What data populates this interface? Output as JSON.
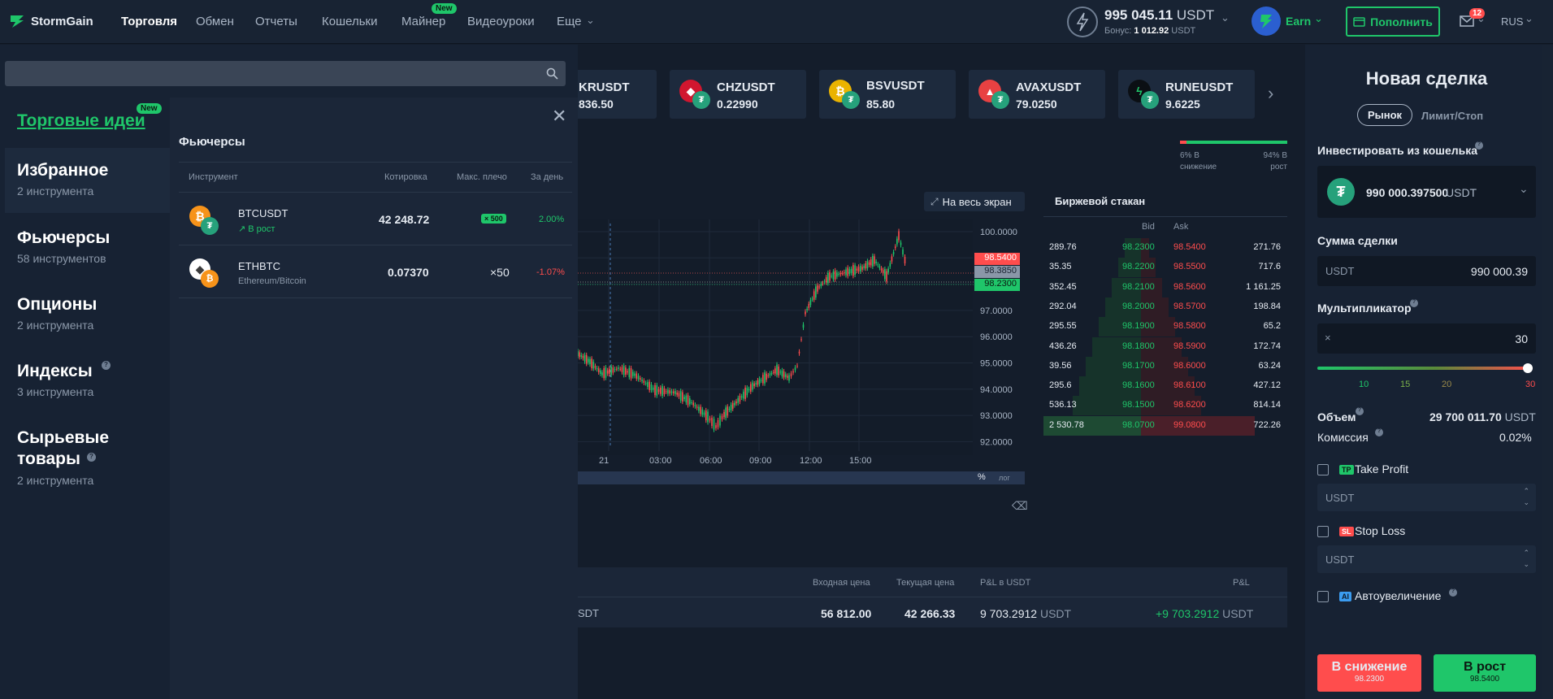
{
  "brand": "StormGain",
  "nav": {
    "items": [
      "Торговля",
      "Обмен",
      "Отчеты",
      "Кошельки",
      "Майнер",
      "Видеоуроки",
      "Еще"
    ],
    "new_badge": "New"
  },
  "balance": {
    "amount": "995 045.11",
    "currency": "USDT",
    "bonus_label": "Бонус:",
    "bonus_value": "1 012.92",
    "bonus_currency": "USDT"
  },
  "earn_label": "Earn",
  "deposit_label": "Пополнить",
  "mail_count": "12",
  "language": "RUS",
  "tickers": [
    {
      "symbol": "KRUSDT",
      "price": "836.50"
    },
    {
      "symbol": "CHZUSDT",
      "price": "0.22990"
    },
    {
      "symbol": "BSVUSDT",
      "price": "85.80"
    },
    {
      "symbol": "AVAXUSDT",
      "price": "79.0250"
    },
    {
      "symbol": "RUNEUSDT",
      "price": "9.6225"
    }
  ],
  "sentiment": {
    "down": "6% В снижение",
    "up": "94% В рост",
    "down_pct": 6,
    "up_pct": 94
  },
  "sidebar": {
    "trade_ideas": "Торговые идеи",
    "new_badge": "New",
    "categories": [
      {
        "title": "Избранное",
        "count": "2 инструмента"
      },
      {
        "title": "Фьючерсы",
        "count": "58 инструментов"
      },
      {
        "title": "Опционы",
        "count": "2 инструмента"
      },
      {
        "title": "Индексы",
        "count": "3 инструмента"
      },
      {
        "title": "Сырьевые товары",
        "count": "2 инструмента"
      }
    ]
  },
  "instrument_panel": {
    "title": "Фьючерсы",
    "columns": [
      "Инструмент",
      "Котировка",
      "Макс. плечо",
      "За день"
    ],
    "rows": [
      {
        "symbol": "BTCUSDT",
        "sub": "В рост",
        "quote": "42 248.72",
        "leverage": "× 500",
        "change": "2.00%"
      },
      {
        "symbol": "ETHBTC",
        "sub": "Ethereum/Bitcoin",
        "quote": "0.07370",
        "leverage": "×50",
        "change": "-1.07%"
      }
    ]
  },
  "chart": {
    "fullscreen_label": "На весь экран",
    "y_ticks": [
      "100.0000",
      "99.0000",
      "98.0000",
      "97.0000",
      "96.0000",
      "95.0000",
      "94.0000",
      "93.0000",
      "92.0000"
    ],
    "x_ticks": [
      "21",
      "03:00",
      "06:00",
      "09:00",
      "12:00",
      "15:00"
    ],
    "ask_tag": "98.5400",
    "mid_tag": "98.3850",
    "bid_tag": "98.2300",
    "pct_label": "%",
    "log_label": "лог"
  },
  "orderbook": {
    "title": "Биржевой стакан",
    "bid_label": "Bid",
    "ask_label": "Ask",
    "rows": [
      [
        "289.76",
        "98.2300",
        "98.5400",
        "271.76"
      ],
      [
        "35.35",
        "98.2200",
        "98.5500",
        "717.6"
      ],
      [
        "352.45",
        "98.2100",
        "98.5600",
        "1 161.25"
      ],
      [
        "292.04",
        "98.2000",
        "98.5700",
        "198.84"
      ],
      [
        "295.55",
        "98.1900",
        "98.5800",
        "65.2"
      ],
      [
        "436.26",
        "98.1800",
        "98.5900",
        "172.74"
      ],
      [
        "39.56",
        "98.1700",
        "98.6000",
        "63.24"
      ],
      [
        "295.6",
        "98.1600",
        "98.6100",
        "427.12"
      ],
      [
        "536.13",
        "98.1500",
        "98.6200",
        "814.14"
      ],
      [
        "2 530.78",
        "98.0700",
        "99.0800",
        "722.26"
      ]
    ]
  },
  "positions": {
    "headers": [
      "Входная цена",
      "Текущая цена",
      "P&L в USDT",
      "P&L"
    ],
    "row": {
      "unit": "SDT",
      "entry": "56 812.00",
      "current": "42 266.33",
      "pnl": "9 703.2912",
      "pnl_unit": "USDT",
      "pnl2": "+9 703.2912",
      "pnl2_unit": "USDT"
    }
  },
  "trade": {
    "title": "Новая сделка",
    "tab_market": "Рынок",
    "tab_limit": "Лимит/Стоп",
    "invest_label": "Инвестировать из кошелька",
    "wallet_amount": "990 000.397500",
    "wallet_currency": "USDT",
    "amount_label": "Сумма сделки",
    "amount_currency": "USDT",
    "amount_value": "990 000.39",
    "multiplier_label": "Мультипликатор",
    "multiplier_prefix": "×",
    "multiplier_value": "30",
    "slider_ticks": [
      "10",
      "15",
      "20",
      "30"
    ],
    "slider_fraction": 1.0,
    "volume_label": "Объем",
    "volume_value": "29 700 011.70",
    "volume_unit": "USDT",
    "fee_label": "Комиссия",
    "fee_value": "0.02%",
    "tp_tag": "TP",
    "tp_label": "Take Profit",
    "tp_placeholder": "USDT",
    "sl_tag": "SL",
    "sl_label": "Stop Loss",
    "sl_placeholder": "USDT",
    "ai_tag": "AI",
    "auto_label": "Автоувеличение",
    "sell_label": "В снижение",
    "sell_price": "98.2300",
    "buy_label": "В рост",
    "buy_price": "98.5400"
  }
}
